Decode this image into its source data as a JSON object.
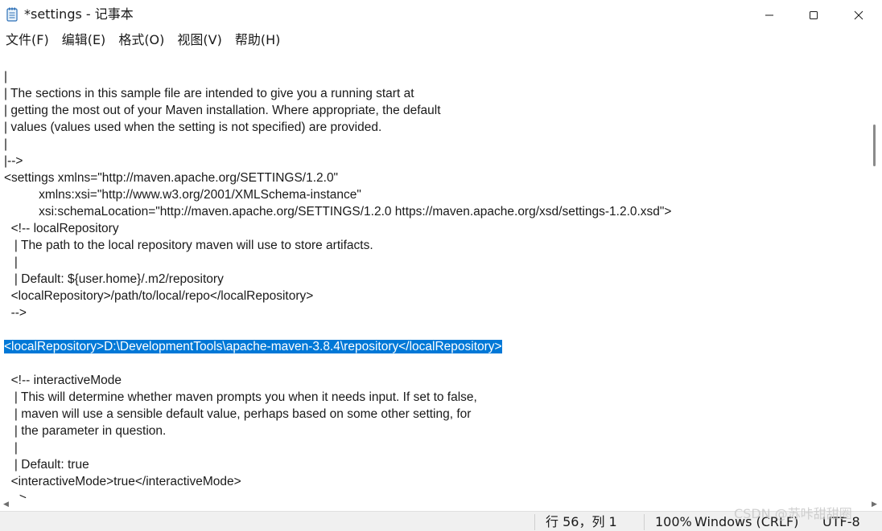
{
  "window": {
    "title": "*settings - 记事本",
    "icon": "notepad-icon"
  },
  "menu": [
    "文件(F)",
    "编辑(E)",
    "格式(O)",
    "视图(V)",
    "帮助(H)"
  ],
  "editor": {
    "lines": [
      "|",
      "| The sections in this sample file are intended to give you a running start at",
      "| getting the most out of your Maven installation. Where appropriate, the default",
      "| values (values used when the setting is not specified) are provided.",
      "|",
      "|-->",
      "<settings xmlns=\"http://maven.apache.org/SETTINGS/1.2.0\"",
      "          xmlns:xsi=\"http://www.w3.org/2001/XMLSchema-instance\"",
      "          xsi:schemaLocation=\"http://maven.apache.org/SETTINGS/1.2.0 https://maven.apache.org/xsd/settings-1.2.0.xsd\">",
      "  <!-- localRepository",
      "   | The path to the local repository maven will use to store artifacts.",
      "   |",
      "   | Default: ${user.home}/.m2/repository",
      "  <localRepository>/path/to/local/repo</localRepository>",
      "  -->",
      "",
      "<localRepository>D:\\DevelopmentTools\\apache-maven-3.8.4\\repository</localRepository>",
      "",
      "  <!-- interactiveMode",
      "   | This will determine whether maven prompts you when it needs input. If set to false,",
      "   | maven will use a sensible default value, perhaps based on some other setting, for",
      "   | the parameter in question.",
      "   |",
      "   | Default: true",
      "  <interactiveMode>true</interactiveMode>",
      "  -->"
    ],
    "selected_line": 16
  },
  "status": {
    "position": "行 56，列 1",
    "zoom": "100%",
    "line_ending": "Windows (CRLF)",
    "encoding": "UTF-8"
  },
  "watermark": "CSDN @苏咔甜甜圈"
}
